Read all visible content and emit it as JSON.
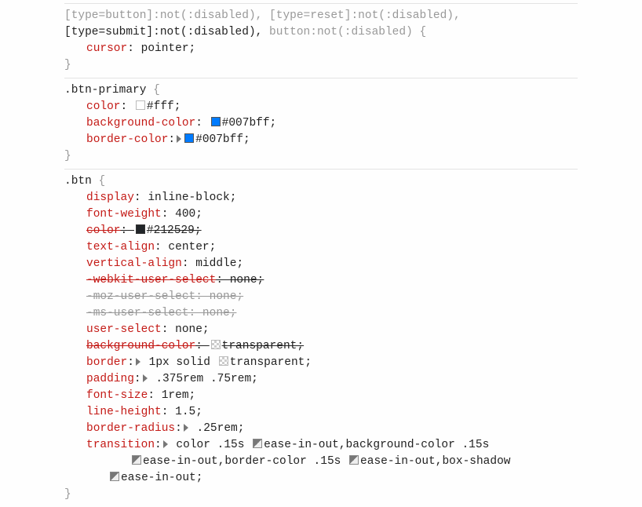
{
  "rules": [
    {
      "selector_parts": [
        {
          "text": "[type=button]:not(:disabled), [type=reset]:not(:disabled), ",
          "dim": true
        },
        {
          "text": "[type=submit]:not(:disabled), ",
          "dim": false
        },
        {
          "text": "button:not(:disabled) {",
          "dim": true
        }
      ],
      "declarations": [
        {
          "prop": "cursor",
          "value": [
            {
              "t": "text",
              "v": " pointer;"
            }
          ],
          "strike": false,
          "dim_all": false,
          "tri": false
        }
      ],
      "close": "}"
    },
    {
      "selector_parts": [
        {
          "text": ".btn-primary ",
          "dim": false
        },
        {
          "text": "{",
          "dim": true
        }
      ],
      "declarations": [
        {
          "prop": "color",
          "value": [
            {
              "t": "text",
              "v": " "
            },
            {
              "t": "sw",
              "v": "fff"
            },
            {
              "t": "text",
              "v": "#fff;"
            }
          ],
          "strike": false,
          "tri": false
        },
        {
          "prop": "background-color",
          "value": [
            {
              "t": "text",
              "v": " "
            },
            {
              "t": "sw",
              "v": "007bff"
            },
            {
              "t": "text",
              "v": "#007bff;"
            }
          ],
          "strike": false,
          "tri": false
        },
        {
          "prop": "border-color",
          "value": [
            {
              "t": "sw",
              "v": "007bff"
            },
            {
              "t": "text",
              "v": "#007bff;"
            }
          ],
          "strike": false,
          "tri": true
        }
      ],
      "close": "}"
    },
    {
      "selector_parts": [
        {
          "text": ".btn ",
          "dim": false
        },
        {
          "text": "{",
          "dim": true
        }
      ],
      "declarations": [
        {
          "prop": "display",
          "value": [
            {
              "t": "text",
              "v": " inline-block;"
            }
          ],
          "strike": false,
          "tri": false
        },
        {
          "prop": "font-weight",
          "value": [
            {
              "t": "text",
              "v": " 400;"
            }
          ],
          "strike": false,
          "tri": false
        },
        {
          "prop": "color",
          "value": [
            {
              "t": "text",
              "v": " "
            },
            {
              "t": "sw",
              "v": "212529"
            },
            {
              "t": "text",
              "v": "#212529;"
            }
          ],
          "strike": true,
          "tri": false
        },
        {
          "prop": "text-align",
          "value": [
            {
              "t": "text",
              "v": " center;"
            }
          ],
          "strike": false,
          "tri": false
        },
        {
          "prop": "vertical-align",
          "value": [
            {
              "t": "text",
              "v": " middle;"
            }
          ],
          "strike": false,
          "tri": false
        },
        {
          "prop": "-webkit-user-select",
          "value": [
            {
              "t": "text",
              "v": " none;"
            }
          ],
          "strike": true,
          "tri": false
        },
        {
          "prop": "-moz-user-select: none;",
          "value": [],
          "strike": false,
          "tri": false,
          "dim_all": true
        },
        {
          "prop": "-ms-user-select: none;",
          "value": [],
          "strike": false,
          "tri": false,
          "dim_all": true
        },
        {
          "prop": "user-select",
          "value": [
            {
              "t": "text",
              "v": " none;"
            }
          ],
          "strike": false,
          "tri": false
        },
        {
          "prop": "background-color",
          "value": [
            {
              "t": "text",
              "v": " "
            },
            {
              "t": "sw",
              "v": "trans"
            },
            {
              "t": "text",
              "v": "transparent;"
            }
          ],
          "strike": true,
          "tri": false
        },
        {
          "prop": "border",
          "value": [
            {
              "t": "text",
              "v": " 1px solid "
            },
            {
              "t": "sw",
              "v": "trans"
            },
            {
              "t": "text",
              "v": "transparent;"
            }
          ],
          "strike": false,
          "tri": true
        },
        {
          "prop": "padding",
          "value": [
            {
              "t": "text",
              "v": " .375rem .75rem;"
            }
          ],
          "strike": false,
          "tri": true
        },
        {
          "prop": "font-size",
          "value": [
            {
              "t": "text",
              "v": " 1rem;"
            }
          ],
          "strike": false,
          "tri": false
        },
        {
          "prop": "line-height",
          "value": [
            {
              "t": "text",
              "v": " 1.5;"
            }
          ],
          "strike": false,
          "tri": false
        },
        {
          "prop": "border-radius",
          "value": [
            {
              "t": "text",
              "v": " .25rem;"
            }
          ],
          "strike": false,
          "tri": true
        },
        {
          "prop": "transition",
          "value": [
            {
              "t": "text",
              "v": " color .15s "
            },
            {
              "t": "sw",
              "v": "ease"
            },
            {
              "t": "text",
              "v": "ease-in-out,background-color .15s "
            },
            {
              "t": "br"
            },
            {
              "t": "sw",
              "v": "ease"
            },
            {
              "t": "text",
              "v": "ease-in-out,border-color .15s "
            },
            {
              "t": "sw",
              "v": "ease"
            },
            {
              "t": "text",
              "v": "ease-in-out,box-shadow "
            },
            {
              "t": "br2"
            },
            {
              "t": "sw",
              "v": "ease"
            },
            {
              "t": "text",
              "v": "ease-in-out;"
            }
          ],
          "strike": false,
          "tri": true
        }
      ],
      "close": "}"
    }
  ]
}
